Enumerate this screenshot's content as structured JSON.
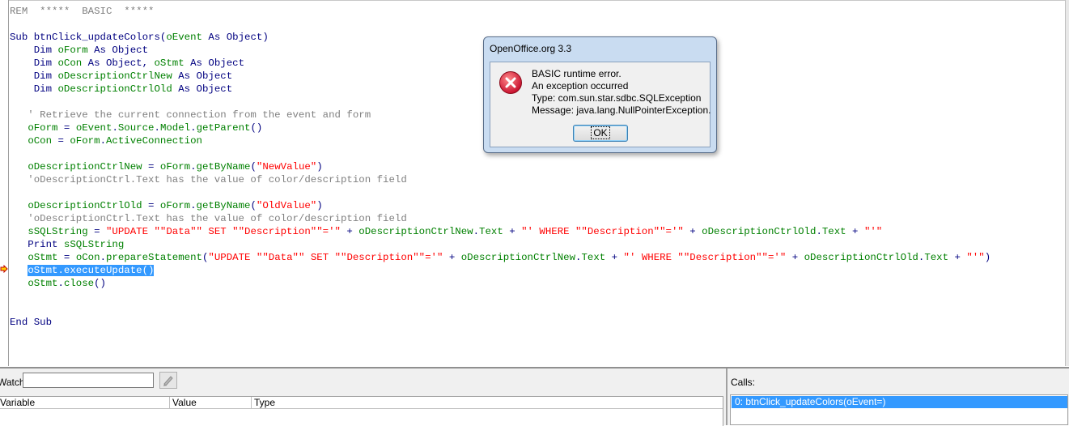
{
  "editor": {
    "lines": [
      [
        {
          "t": "REM  *****  BASIC  *****",
          "c": "cm"
        }
      ],
      [],
      [
        {
          "t": "Sub ",
          "c": "kw"
        },
        {
          "t": "btnClick_updateColors",
          "c": "kw"
        },
        {
          "t": "(",
          "c": "kw"
        },
        {
          "t": "oEvent",
          "c": "id"
        },
        {
          "t": " As Object)",
          "c": "kw"
        }
      ],
      [
        {
          "t": "    Dim ",
          "c": "kw"
        },
        {
          "t": "oForm",
          "c": "id"
        },
        {
          "t": " As Object",
          "c": "kw"
        }
      ],
      [
        {
          "t": "    Dim ",
          "c": "kw"
        },
        {
          "t": "oCon",
          "c": "id"
        },
        {
          "t": " As Object, ",
          "c": "kw"
        },
        {
          "t": "oStmt",
          "c": "id"
        },
        {
          "t": " As Object",
          "c": "kw"
        }
      ],
      [
        {
          "t": "    Dim ",
          "c": "kw"
        },
        {
          "t": "oDescriptionCtrlNew",
          "c": "id"
        },
        {
          "t": " As Object",
          "c": "kw"
        }
      ],
      [
        {
          "t": "    Dim ",
          "c": "kw"
        },
        {
          "t": "oDescriptionCtrlOld",
          "c": "id"
        },
        {
          "t": " As Object",
          "c": "kw"
        }
      ],
      [],
      [
        {
          "t": "   ' Retrieve the current connection from the event and form",
          "c": "cm"
        }
      ],
      [
        {
          "t": "   ",
          "c": "plain"
        },
        {
          "t": "oForm",
          "c": "id"
        },
        {
          "t": " = ",
          "c": "plain"
        },
        {
          "t": "oEvent",
          "c": "id"
        },
        {
          "t": ".",
          "c": "plain"
        },
        {
          "t": "Source",
          "c": "id"
        },
        {
          "t": ".",
          "c": "plain"
        },
        {
          "t": "Model",
          "c": "id"
        },
        {
          "t": ".",
          "c": "plain"
        },
        {
          "t": "getParent",
          "c": "id"
        },
        {
          "t": "()",
          "c": "plain"
        }
      ],
      [
        {
          "t": "   ",
          "c": "plain"
        },
        {
          "t": "oCon",
          "c": "id"
        },
        {
          "t": " = ",
          "c": "plain"
        },
        {
          "t": "oForm",
          "c": "id"
        },
        {
          "t": ".",
          "c": "plain"
        },
        {
          "t": "ActiveConnection",
          "c": "id"
        }
      ],
      [],
      [
        {
          "t": "   ",
          "c": "plain"
        },
        {
          "t": "oDescriptionCtrlNew",
          "c": "id"
        },
        {
          "t": " = ",
          "c": "plain"
        },
        {
          "t": "oForm",
          "c": "id"
        },
        {
          "t": ".",
          "c": "plain"
        },
        {
          "t": "getByName",
          "c": "id"
        },
        {
          "t": "(",
          "c": "plain"
        },
        {
          "t": "\"NewValue\"",
          "c": "str"
        },
        {
          "t": ")",
          "c": "plain"
        }
      ],
      [
        {
          "t": "   'oDescriptionCtrl.Text has the value of color/description field",
          "c": "cm"
        }
      ],
      [],
      [
        {
          "t": "   ",
          "c": "plain"
        },
        {
          "t": "oDescriptionCtrlOld",
          "c": "id"
        },
        {
          "t": " = ",
          "c": "plain"
        },
        {
          "t": "oForm",
          "c": "id"
        },
        {
          "t": ".",
          "c": "plain"
        },
        {
          "t": "getByName",
          "c": "id"
        },
        {
          "t": "(",
          "c": "plain"
        },
        {
          "t": "\"OldValue\"",
          "c": "str"
        },
        {
          "t": ")",
          "c": "plain"
        }
      ],
      [
        {
          "t": "   'oDescriptionCtrl.Text has the value of color/description field",
          "c": "cm"
        }
      ],
      [
        {
          "t": "   ",
          "c": "plain"
        },
        {
          "t": "sSQLString",
          "c": "id"
        },
        {
          "t": " = ",
          "c": "plain"
        },
        {
          "t": "\"UPDATE \"\"Data\"\" SET \"\"Description\"\"='\"",
          "c": "str"
        },
        {
          "t": " + ",
          "c": "plain"
        },
        {
          "t": "oDescriptionCtrlNew",
          "c": "id"
        },
        {
          "t": ".",
          "c": "plain"
        },
        {
          "t": "Text",
          "c": "id"
        },
        {
          "t": " + ",
          "c": "plain"
        },
        {
          "t": "\"' WHERE \"\"Description\"\"='\"",
          "c": "str"
        },
        {
          "t": " + ",
          "c": "plain"
        },
        {
          "t": "oDescriptionCtrlOld",
          "c": "id"
        },
        {
          "t": ".",
          "c": "plain"
        },
        {
          "t": "Text",
          "c": "id"
        },
        {
          "t": " + ",
          "c": "plain"
        },
        {
          "t": "\"'\"",
          "c": "str"
        }
      ],
      [
        {
          "t": "   Print ",
          "c": "kw"
        },
        {
          "t": "sSQLString",
          "c": "id"
        }
      ],
      [
        {
          "t": "   ",
          "c": "plain"
        },
        {
          "t": "oStmt",
          "c": "id"
        },
        {
          "t": " = ",
          "c": "plain"
        },
        {
          "t": "oCon",
          "c": "id"
        },
        {
          "t": ".",
          "c": "plain"
        },
        {
          "t": "prepareStatement",
          "c": "id"
        },
        {
          "t": "(",
          "c": "plain"
        },
        {
          "t": "\"UPDATE \"\"Data\"\" SET \"\"Description\"\"='\"",
          "c": "str"
        },
        {
          "t": " + ",
          "c": "plain"
        },
        {
          "t": "oDescriptionCtrlNew",
          "c": "id"
        },
        {
          "t": ".",
          "c": "plain"
        },
        {
          "t": "Text",
          "c": "id"
        },
        {
          "t": " + ",
          "c": "plain"
        },
        {
          "t": "\"' WHERE \"\"Description\"\"='\"",
          "c": "str"
        },
        {
          "t": " + ",
          "c": "plain"
        },
        {
          "t": "oDescriptionCtrlOld",
          "c": "id"
        },
        {
          "t": ".",
          "c": "plain"
        },
        {
          "t": "Text",
          "c": "id"
        },
        {
          "t": " + ",
          "c": "plain"
        },
        {
          "t": "\"'\"",
          "c": "str"
        },
        {
          "t": ")",
          "c": "plain"
        }
      ],
      [
        {
          "t": "   ",
          "c": "plain"
        },
        {
          "t": "oStmt.executeUpdate()",
          "c": "hl"
        }
      ],
      [
        {
          "t": "   ",
          "c": "plain"
        },
        {
          "t": "oStmt",
          "c": "id"
        },
        {
          "t": ".",
          "c": "plain"
        },
        {
          "t": "close",
          "c": "id"
        },
        {
          "t": "()",
          "c": "plain"
        }
      ],
      [],
      [],
      [
        {
          "t": "End Sub",
          "c": "kw"
        }
      ]
    ]
  },
  "watch": {
    "label": "Watch:",
    "value": "",
    "columns": [
      "Variable",
      "Value",
      "Type"
    ]
  },
  "calls": {
    "label": "Calls:",
    "items": [
      "0: btnClick_updateColors(oEvent=)"
    ]
  },
  "dialog": {
    "title": "OpenOffice.org 3.3",
    "icon": "error-icon",
    "message": [
      "BASIC runtime error.",
      "An exception occurred",
      "Type: com.sun.star.sdbc.SQLException",
      "Message: java.lang.NullPointerException."
    ],
    "ok_label": "OK"
  },
  "colors": {
    "keyword": "#000080",
    "identifier": "#008000",
    "string": "#ff0000",
    "comment": "#808080",
    "selection": "#3399ff",
    "error_icon": "#e81123"
  }
}
